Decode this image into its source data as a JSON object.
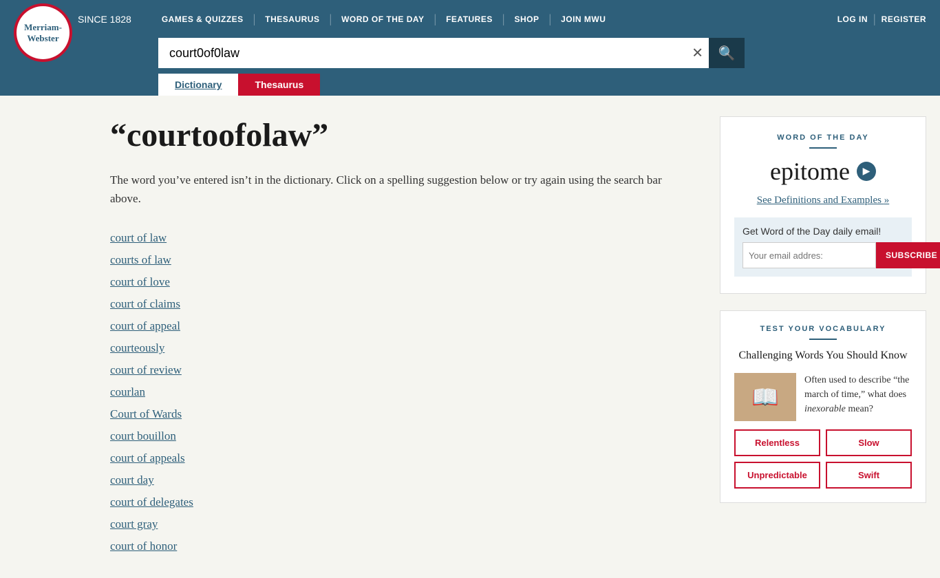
{
  "header": {
    "logo_line1": "Merriam-",
    "logo_line2": "Webster",
    "since": "SINCE 1828",
    "nav": {
      "games": "GAMES & QUIZZES",
      "thesaurus": "THESAURUS",
      "word_of_day": "WORD OF THE DAY",
      "features": "FEATURES",
      "shop": "SHOP",
      "join": "JOIN MWU",
      "login": "LOG IN",
      "register": "REGISTER"
    },
    "search_value": "court0of0law",
    "tab_dictionary": "Dictionary",
    "tab_thesaurus": "Thesaurus"
  },
  "main": {
    "title": "“courtoofolaw”",
    "not_found_text": "The word you’ve entered isn’t in the dictionary. Click on a spelling suggestion below or try again using the search bar above.",
    "suggestions": [
      "court of law",
      "courts of law",
      "court of love",
      "court of claims",
      "court of appeal",
      "courteously",
      "court of review",
      "courlan",
      "Court of Wards",
      "court bouillon",
      "court of appeals",
      "court day",
      "court of delegates",
      "court gray",
      "court of honor"
    ]
  },
  "sidebar": {
    "wotd": {
      "label": "WORD OF THE DAY",
      "word": "epitome",
      "see_link": "See Definitions and Examples",
      "see_suffix": " »",
      "email_label": "Get Word of the Day daily email!",
      "email_placeholder": "Your email addres:",
      "subscribe_btn": "SUBSCRIBE"
    },
    "vocab": {
      "label": "TEST YOUR VOCABULARY",
      "title": "Challenging Words You Should Know",
      "desc_prefix": "Often used to describe “the march of time,” what does ",
      "desc_word": "inexorable",
      "desc_suffix": " mean?",
      "choices": [
        "Relentless",
        "Slow",
        "Unpredictable",
        "Swift"
      ]
    }
  }
}
